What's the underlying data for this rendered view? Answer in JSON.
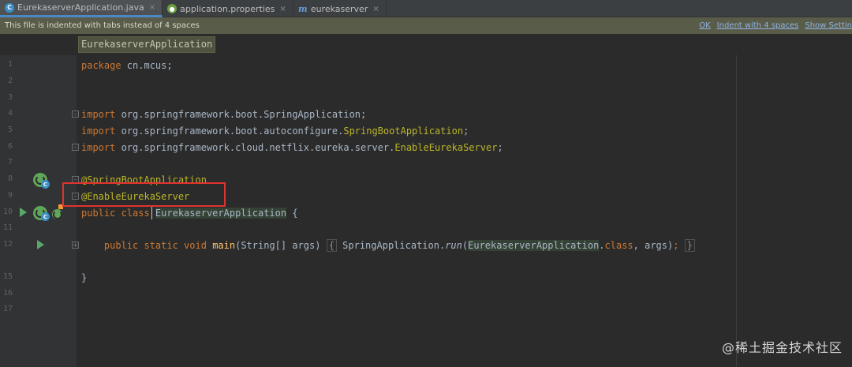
{
  "tabs": [
    {
      "label": "EurekaserverApplication.java",
      "icon": "java-class-icon",
      "active": true
    },
    {
      "label": "application.properties",
      "icon": "properties-file-icon",
      "active": false
    },
    {
      "label": "eurekaserver",
      "icon": "maven-module-icon",
      "active": false
    }
  ],
  "tab_close": "×",
  "notification": {
    "message": "This file is indented with tabs instead of 4 spaces",
    "ok": "OK",
    "indent": "Indent with 4 spaces",
    "settings": "Show Settin"
  },
  "breadcrumb": "EurekaserverApplication",
  "line_numbers": [
    "1",
    "2",
    "3",
    "4",
    "5",
    "6",
    "7",
    "8",
    "9",
    "10",
    "11",
    "12",
    "15",
    "16",
    "17"
  ],
  "code": {
    "l1_kw": "package",
    "l1_rest": " cn.mcus;",
    "l4_kw": "import",
    "l4_rest": " org.springframework.boot.SpringApplication;",
    "l5_kw": "import",
    "l5_mid": " org.springframework.boot.autoconfigure.",
    "l5_ann": "SpringBootApplication",
    "l5_end": ";",
    "l6_kw": "import",
    "l6_mid": " org.springframework.cloud.netflix.eureka.server.",
    "l6_ann": "EnableEurekaServer",
    "l6_end": ";",
    "l8": "@SpringBootApplication",
    "l9": "@EnableEurekaServer",
    "l10_kw": "public class ",
    "l10_cls": "EurekaserverApplication",
    "l10_end": " {",
    "l12_indent": "    ",
    "l12_kw": "public static void ",
    "l12_fn": "main",
    "l12_args": "(String[] args) ",
    "l12_open": "{",
    "l12_body": " SpringApplication.",
    "l12_run": "run",
    "l12_paren": "(",
    "l12_cls": "EurekaserverApplication",
    "l12_dot": ".",
    "l12_class_kw": "class",
    "l12_tail": ", args)",
    "l12_semi": ";",
    "l12_close": "}",
    "l16": "}"
  },
  "watermark": "@稀土掘金技术社区"
}
